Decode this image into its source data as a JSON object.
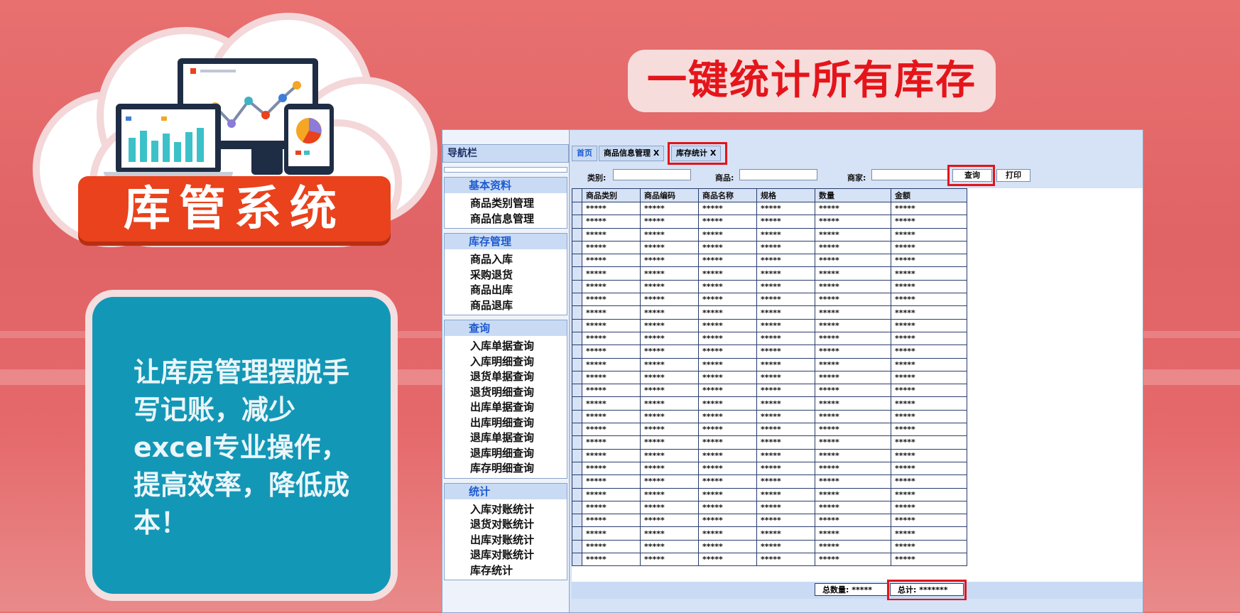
{
  "banner": {
    "title": "库管系统"
  },
  "headline": "一键统计所有库存",
  "card_text": "让库房管理摆脱手写记账，减少excel专业操作，提高效率，降低成本！",
  "nav": {
    "title": "导航栏",
    "groups": [
      {
        "title": "基本资料",
        "items": [
          "商品类别管理",
          "商品信息管理"
        ]
      },
      {
        "title": "库存管理",
        "items": [
          "商品入库",
          "采购退货",
          "商品出库",
          "商品退库"
        ]
      },
      {
        "title": "查询",
        "items": [
          "入库单据查询",
          "入库明细查询",
          "退货单据查询",
          "退货明细查询",
          "出库单据查询",
          "出库明细查询",
          "退库单据查询",
          "退库明细查询",
          "库存明细查询"
        ]
      },
      {
        "title": "统计",
        "items": [
          "入库对账统计",
          "退货对账统计",
          "出库对账统计",
          "退库对账统计",
          "库存统计"
        ]
      }
    ]
  },
  "tabs": {
    "home": "首页",
    "product_info": "商品信息管理  X",
    "stock_stats": "库存统计 X"
  },
  "filter": {
    "category_label": "类别:",
    "product_label": "商品:",
    "merchant_label": "商家:",
    "query_button": "查询",
    "print_button": "打印"
  },
  "table": {
    "headers": [
      "商品类别",
      "商品编码",
      "商品名称",
      "规格",
      "数量",
      "金额"
    ],
    "masked_value": "*****",
    "row_count": 28
  },
  "footer": {
    "total_qty": "总数量: *****",
    "total": "总计: *******"
  },
  "colors": {
    "highlight": "#e0151b",
    "card": "#1397b6",
    "banner": "#e9421c"
  }
}
